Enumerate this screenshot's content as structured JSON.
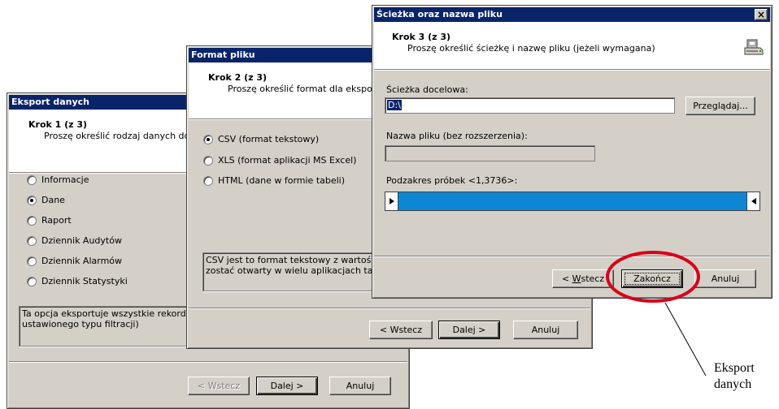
{
  "dialog1": {
    "title": "Eksport danych",
    "step": "Krok 1 (z 3)",
    "subtitle": "Proszę określić rodzaj danych do",
    "options": [
      {
        "label": "Informacje",
        "checked": false
      },
      {
        "label": "Dane",
        "checked": true
      },
      {
        "label": "Raport",
        "checked": false
      },
      {
        "label": "Dziennik Audytów",
        "checked": false
      },
      {
        "label": "Dziennik Alarmów",
        "checked": false
      },
      {
        "label": "Dziennik Statystyki",
        "checked": false
      }
    ],
    "description_line1": "Ta opcja eksportuje wszystkie rekordy",
    "description_line2": "ustawionego typu filtracji)",
    "back_label": "< Wstecz",
    "next_label": "Dalej >",
    "cancel_label": "Anuluj"
  },
  "dialog2": {
    "title": "Format pliku",
    "step": "Krok 2 (z 3)",
    "subtitle": "Proszę określić format dla eksport",
    "options": [
      {
        "label": "CSV (format tekstowy)",
        "checked": true
      },
      {
        "label": "XLS (format aplikacji MS Excel)",
        "checked": false
      },
      {
        "label": "HTML (dane w formie tabeli)",
        "checked": false
      }
    ],
    "description_line1": "CSV jest to format tekstowy z wartości",
    "description_line2": "zostać otwarty w wielu aplikacjach takic",
    "back_label": "< Wstecz",
    "next_label": "Dalej >",
    "cancel_label": "Anuluj"
  },
  "dialog3": {
    "title": "Ścieżka oraz nazwa pliku",
    "close_glyph": "×",
    "step": "Krok 3 (z 3)",
    "subtitle": "Proszę określić ścieżkę i nazwę pliku (jeżeli wymagana)",
    "path_label": "Ścieżka docelowa:",
    "path_value": "D:\\",
    "browse_label": "Przeglądaj...",
    "filename_label": "Nazwa pliku (bez rozszerzenia):",
    "filename_value": "",
    "range_label": "Podzakres próbek <1,3736>:",
    "range_fraction": 1.0,
    "back_label_prefix": "< ",
    "back_label_hotkey": "W",
    "back_label_rest": "stecz",
    "finish_label": "Zakończ",
    "cancel_label": "Anuluj"
  },
  "annotation": {
    "line1": "Eksport",
    "line2": "danych",
    "highlight_color": "#d9001b"
  }
}
